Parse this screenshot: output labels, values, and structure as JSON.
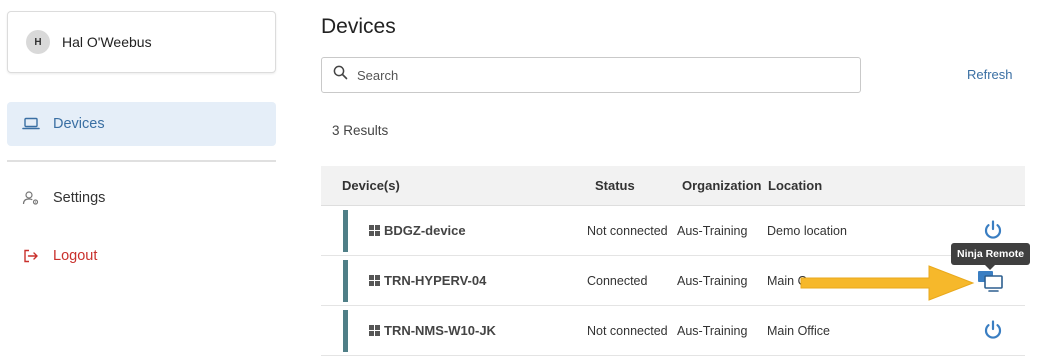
{
  "user": {
    "initial": "H",
    "name": "Hal O'Weebus"
  },
  "nav": {
    "devices": "Devices",
    "settings": "Settings",
    "logout": "Logout"
  },
  "page": {
    "title": "Devices",
    "search_placeholder": "Search",
    "refresh": "Refresh",
    "results": "3 Results"
  },
  "table": {
    "headers": [
      "Device(s)",
      "Status",
      "Organization",
      "Location"
    ],
    "rows": [
      {
        "device": "BDGZ-device",
        "status": "Not connected",
        "organization": "Aus-Training",
        "location": "Demo location",
        "action": "power-icon"
      },
      {
        "device": "TRN-HYPERV-04",
        "status": "Connected",
        "organization": "Aus-Training",
        "location": "Main O",
        "action": "remote-icon"
      },
      {
        "device": "TRN-NMS-W10-JK",
        "status": "Not connected",
        "organization": "Aus-Training",
        "location": "Main Office",
        "action": "power-icon"
      }
    ]
  },
  "tooltip": "Ninja Remote",
  "colors": {
    "accent": "#3a6fa3",
    "active_nav_bg": "#e5eef8",
    "logout": "#c9302c",
    "row_bar": "#4f7f87",
    "arrow": "#f6b82b"
  }
}
